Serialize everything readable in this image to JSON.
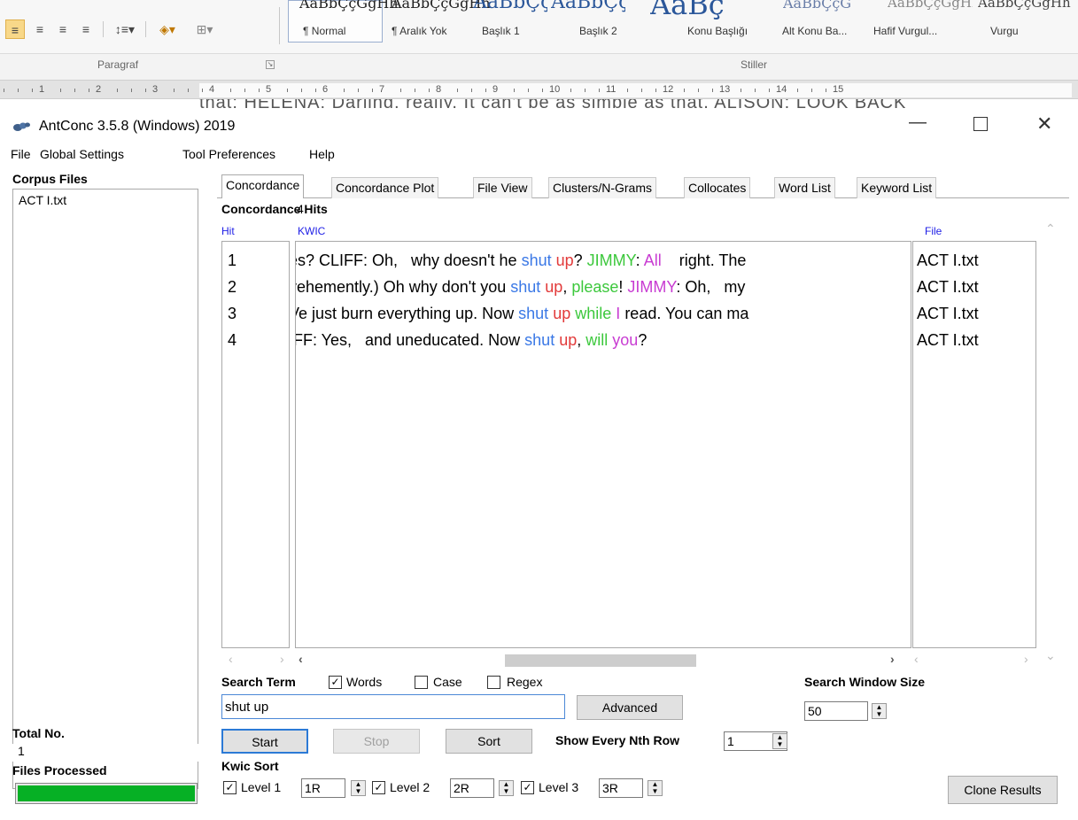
{
  "word_ribbon": {
    "style_previews": [
      "AaBbÇçĞğHh",
      "AaBbÇçĞğHh",
      "AaBbÇçĞ",
      "AaBbÇçĞ",
      "AaBç",
      "AaBbÇçĞ",
      "AaBbÇçĞğHh",
      "AaBbÇçĞğHh"
    ],
    "style_names": [
      "¶ Normal",
      "¶ Aralık Yok",
      "Başlık 1",
      "Başlık 2",
      "Konu Başlığı",
      "Alt Konu Ba...",
      "Hafif Vurgul...",
      "Vurgu"
    ],
    "group_paragraph": "Paragraf",
    "group_styles": "Stiller",
    "ruler_numbers": [
      "1",
      "2",
      "3",
      "4",
      "5",
      "6",
      "7",
      "8",
      "9",
      "10",
      "11",
      "12",
      "13",
      "14",
      "15"
    ],
    "doc_text_fragment": "that: HELENA: Darling, really. It can't be as simple as that. ALISON: LOOK BACK"
  },
  "app": {
    "title": "AntConc 3.5.8 (Windows) 2019",
    "menu": [
      "File",
      "Global Settings",
      "Tool Preferences",
      "Help"
    ]
  },
  "corpus": {
    "label": "Corpus Files",
    "files": [
      "ACT I.txt"
    ],
    "total_label": "Total No.",
    "total_value": "1",
    "processed_label": "Files Processed",
    "progress": 1.0
  },
  "tabs": [
    "Concordance",
    "Concordance Plot",
    "File View",
    "Clusters/N-Grams",
    "Collocates",
    "Word List",
    "Keyword List"
  ],
  "results": {
    "hits_label": "Concordance Hits",
    "hits_count": "4",
    "col_hit": "Hit",
    "col_kwic": "KWIC",
    "col_file": "File",
    "rows": [
      {
        "hit": "1",
        "file": "ACT I.txt",
        "segments": [
          {
            "text": "es? CLIFF: Oh,   why doesn't he ",
            "color": "black"
          },
          {
            "text": "shut",
            "color": "blue"
          },
          {
            "text": " ",
            "color": "black"
          },
          {
            "text": "up",
            "color": "red"
          },
          {
            "text": "? ",
            "color": "black"
          },
          {
            "text": "JIMMY",
            "color": "green"
          },
          {
            "text": ": ",
            "color": "black"
          },
          {
            "text": "All",
            "color": "magenta"
          },
          {
            "text": "    right. The",
            "color": "black"
          }
        ]
      },
      {
        "hit": "2",
        "file": "ACT I.txt",
        "segments": [
          {
            "text": "vehemently.) Oh why don't you ",
            "color": "black"
          },
          {
            "text": "shut",
            "color": "blue"
          },
          {
            "text": " ",
            "color": "black"
          },
          {
            "text": "up",
            "color": "red"
          },
          {
            "text": ", ",
            "color": "black"
          },
          {
            "text": "please",
            "color": "green"
          },
          {
            "text": "! ",
            "color": "black"
          },
          {
            "text": "JIMMY",
            "color": "magenta"
          },
          {
            "text": ": Oh,   my",
            "color": "black"
          }
        ]
      },
      {
        "hit": "3",
        "file": "ACT I.txt",
        "segments": [
          {
            "text": "Ve just burn everything up. Now ",
            "color": "black"
          },
          {
            "text": "shut",
            "color": "blue"
          },
          {
            "text": " ",
            "color": "black"
          },
          {
            "text": "up",
            "color": "red"
          },
          {
            "text": " ",
            "color": "black"
          },
          {
            "text": "while",
            "color": "green"
          },
          {
            "text": " ",
            "color": "black"
          },
          {
            "text": "I",
            "color": "magenta"
          },
          {
            "text": " read. You can ma",
            "color": "black"
          }
        ]
      },
      {
        "hit": "4",
        "file": "ACT I.txt",
        "segments": [
          {
            "text": "IFF: Yes,   and uneducated. Now ",
            "color": "black"
          },
          {
            "text": "shut",
            "color": "blue"
          },
          {
            "text": " ",
            "color": "black"
          },
          {
            "text": "up",
            "color": "red"
          },
          {
            "text": ", ",
            "color": "black"
          },
          {
            "text": "will",
            "color": "green"
          },
          {
            "text": " ",
            "color": "black"
          },
          {
            "text": "you",
            "color": "magenta"
          },
          {
            "text": "?",
            "color": "black"
          }
        ]
      }
    ]
  },
  "search": {
    "label": "Search Term",
    "words_label": "Words",
    "words_checked": true,
    "case_label": "Case",
    "case_checked": false,
    "regex_label": "Regex",
    "regex_checked": false,
    "term": "shut up",
    "advanced_label": "Advanced",
    "start_label": "Start",
    "stop_label": "Stop",
    "sort_label": "Sort",
    "nth_label": "Show Every Nth Row",
    "nth_value": "1",
    "window_size_label": "Search Window Size",
    "window_size_value": "50"
  },
  "kwic_sort": {
    "label": "Kwic Sort",
    "levels": [
      {
        "label": "Level 1",
        "value": "1R",
        "checked": true
      },
      {
        "label": "Level 2",
        "value": "2R",
        "checked": true
      },
      {
        "label": "Level 3",
        "value": "3R",
        "checked": true
      }
    ],
    "clone_label": "Clone Results"
  },
  "colors": {
    "blue": "#3a78e6",
    "red": "#e23a3a",
    "green": "#3cc83c",
    "magenta": "#c83cd2",
    "header_blue": "#1e1ee6",
    "progress_green": "#06b025"
  }
}
